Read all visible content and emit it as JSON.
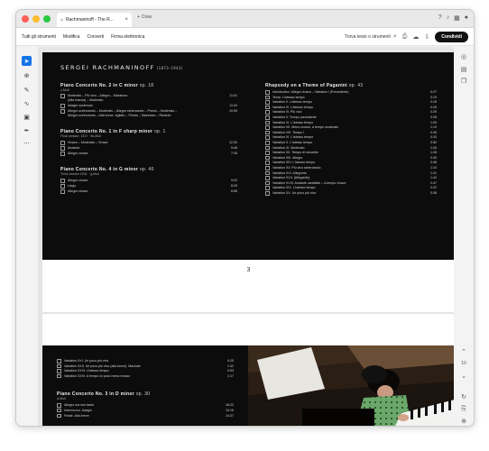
{
  "window": {
    "tab_title": "Rachmaninoff - The R...",
    "new_tab_label": "Crea"
  },
  "toolbar": {
    "menu": [
      "Tutti gli strumenti",
      "Modifica",
      "Converti",
      "Firma elettronica"
    ],
    "search_label": "Trova testo o strumenti",
    "share_label": "Condividi"
  },
  "zoom_marker": "10",
  "page1": {
    "composer": "SERGEI RACHMANINOFF",
    "years": "(1873–1943)",
    "page_number": "3",
    "left_works": [
      {
        "title": "Piano Concerto No. 2 in C minor",
        "opus": "op. 18",
        "subtitle": "c-Moll",
        "tracks": [
          {
            "num": "1",
            "title": "Moderato – Più vivo – Allegro – Maestoso",
            "cont": "(Alla marcia) – Moderato",
            "dur": "11:01"
          },
          {
            "num": "2",
            "title": "Adagio sostenuto",
            "cont": "",
            "dur": "11:04"
          },
          {
            "num": "3",
            "title": "Allegro scherzando – Moderato – Allegro scherzando – Presto – Moderato –",
            "cont": "Allegro scherzando – Alla breve. Agitato – Presto – Maestoso – Risoluto",
            "dur": "10:59"
          }
        ]
      },
      {
        "title": "Piano Concerto No. 1 in F sharp minor",
        "opus": "op. 1",
        "subtitle": "Final version: 1917 · fis-Moll",
        "tracks": [
          {
            "num": "4",
            "title": "Vivace – Moderato – Vivace",
            "cont": "",
            "dur": "12:30"
          },
          {
            "num": "5",
            "title": "Andante",
            "cont": "",
            "dur": "5:48"
          },
          {
            "num": "6",
            "title": "Allegro vivace",
            "cont": "",
            "dur": "7:35"
          }
        ]
      },
      {
        "title": "Piano Concerto No. 4 in G minor",
        "opus": "op. 40",
        "subtitle": "Third version 1941 · g-Moll",
        "tracks": [
          {
            "num": "7",
            "title": "Allegro vivace",
            "cont": "",
            "dur": "9:02"
          },
          {
            "num": "8",
            "title": "Largo",
            "cont": "",
            "dur": "6:29"
          },
          {
            "num": "9",
            "title": "Allegro vivace",
            "cont": "",
            "dur": "8:56"
          }
        ]
      }
    ],
    "right_work": {
      "title": "Rhapsody on a Theme of Paganini",
      "opus": "op. 43",
      "tracks": [
        {
          "num": "10",
          "title": "Introduction. Allegro vivace – Variation I (Precedente)",
          "dur": "0:27"
        },
        {
          "num": "11",
          "title": "Tema. L'istesso tempo",
          "dur": "0:19"
        },
        {
          "num": "12",
          "title": "Variation II. L'istesso tempo",
          "dur": "0:19"
        },
        {
          "num": "13",
          "title": "Variation III. L'istesso tempo",
          "dur": "0:25"
        },
        {
          "num": "14",
          "title": "Variation IV. Più vivo",
          "dur": "0:29"
        },
        {
          "num": "15",
          "title": "Variation V. Tempo precedente",
          "dur": "0:28"
        },
        {
          "num": "16",
          "title": "Variation VI. L'istesso tempo",
          "dur": "1:09"
        },
        {
          "num": "17",
          "title": "Variation VII. Meno mosso, a tempo moderato",
          "dur": "1:10"
        },
        {
          "num": "18",
          "title": "Variation VIII. Tempo I",
          "dur": "0:35"
        },
        {
          "num": "19",
          "title": "Variation IX. L'istesso tempo",
          "dur": "0:33"
        },
        {
          "num": "20",
          "title": "Variation X. L'istesso tempo",
          "dur": "0:52"
        },
        {
          "num": "21",
          "title": "Variation XI. Moderato",
          "dur": "1:26"
        },
        {
          "num": "22",
          "title": "Variation XII. Tempo di minuetto",
          "dur": "1:28"
        },
        {
          "num": "23",
          "title": "Variation XIII. Allegro",
          "dur": "0:30"
        },
        {
          "num": "24",
          "title": "Variation XIV. L'istesso tempo",
          "dur": "0:46"
        },
        {
          "num": "25",
          "title": "Variation XV. Più vivo scherzando",
          "dur": "1:10"
        },
        {
          "num": "26",
          "title": "Variation XVI. Allegretto",
          "dur": "1:41"
        },
        {
          "num": "27",
          "title": "Variation XVII. [Allegretto]",
          "dur": "1:42"
        },
        {
          "num": "28",
          "title": "Variation XVIII. Andante cantabile – A tempo vivace",
          "dur": "2:47"
        },
        {
          "num": "29",
          "title": "Variation XIX. L'istesso tempo",
          "dur": "0:22"
        },
        {
          "num": "30",
          "title": "Variation XX. Un poco più vivo",
          "dur": "0:36"
        }
      ]
    }
  },
  "page2": {
    "tracks_top": [
      {
        "num": "31",
        "title": "Variation XXI. Un poco più vivo",
        "dur": "0:25"
      },
      {
        "num": "32",
        "title": "Variation XXII. Un poco più vivo (alla breve). Marziale",
        "dur": "1:42"
      },
      {
        "num": "33",
        "title": "Variation XXIII. L'istesso tempo",
        "dur": "0:53"
      },
      {
        "num": "34",
        "title": "Variation XXIV. A tempo un poco meno mosso",
        "dur": "1:17"
      }
    ],
    "work": {
      "title": "Piano Concerto No. 3 in D minor",
      "opus": "op. 30",
      "subtitle": "d-Moll",
      "tracks": [
        {
          "num": "1",
          "title": "Allegro ma non tanto",
          "dur": "16:23"
        },
        {
          "num": "2",
          "title": "Intermezzo. Adagio",
          "dur": "10:16"
        },
        {
          "num": "3",
          "title": "Finale. Alla breve",
          "dur": "14:27"
        }
      ]
    }
  },
  "colors": {
    "accent": "#1473e6",
    "page_black": "#0c0c0c"
  }
}
